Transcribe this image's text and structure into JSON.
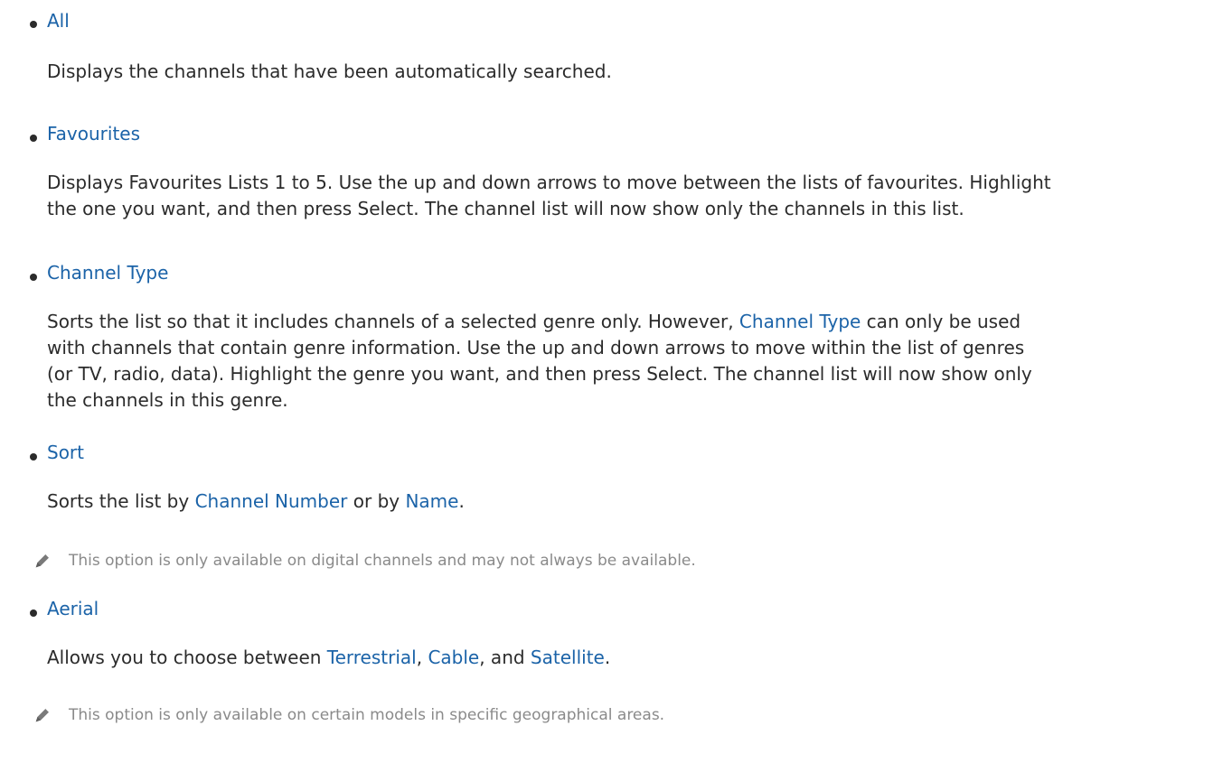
{
  "items": [
    {
      "title": "All",
      "description": [
        "Displays the channels that have been automatically searched."
      ]
    },
    {
      "title": "Favourites",
      "description": [
        "Displays Favourites Lists 1 to 5. Use the up and down arrows to move between the lists of favourites. Highlight",
        "the one you want, and then press Select. The channel list will now show only the channels in this list."
      ]
    },
    {
      "title": "Channel Type",
      "description_parts": {
        "line1_a": "Sorts the list so that it includes channels of a selected genre only. However, ",
        "line1_link": "Channel Type",
        "line1_b": " can only be used",
        "line2": "with channels that contain genre information. Use the up and down arrows to move within the list of genres",
        "line3": "(or TV, radio, data). Highlight the genre you want, and then press Select. The channel list will now show only",
        "line4": "the channels in this genre."
      }
    },
    {
      "title": "Sort",
      "description_parts": {
        "a": "Sorts the list by ",
        "link1": "Channel Number",
        "b": " or by ",
        "link2": "Name",
        "c": "."
      },
      "note": "This option is only available on digital channels and may not always be available."
    },
    {
      "title": "Aerial",
      "description_parts": {
        "a": "Allows you to choose between ",
        "link1": "Terrestrial",
        "b": ", ",
        "link2": "Cable",
        "c": ", and ",
        "link3": "Satellite",
        "d": "."
      },
      "note": "This option is only available on certain models in specific geographical areas."
    }
  ],
  "icons": {
    "note": "pencil-icon"
  },
  "colors": {
    "link": "#1b63a8",
    "text": "#2b2b2b",
    "note": "#8a8a8a"
  }
}
